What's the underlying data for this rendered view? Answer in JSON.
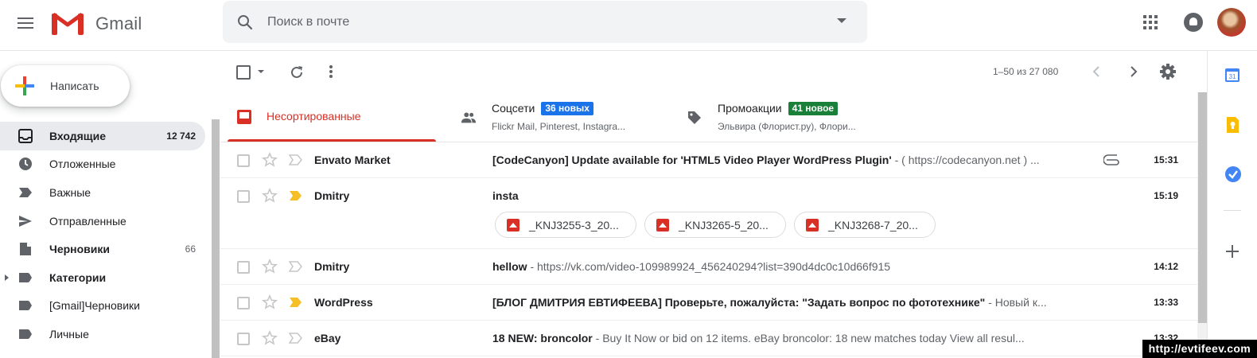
{
  "app": {
    "name": "Gmail"
  },
  "search": {
    "placeholder": "Поиск в почте"
  },
  "compose": {
    "label": "Написать"
  },
  "sidebar": {
    "items": [
      {
        "label": "Входящие",
        "count": "12 742",
        "icon": "inbox-icon",
        "bold": true,
        "active": true
      },
      {
        "label": "Отложенные",
        "count": "",
        "icon": "clock-icon"
      },
      {
        "label": "Важные",
        "count": "",
        "icon": "important-icon"
      },
      {
        "label": "Отправленные",
        "count": "",
        "icon": "send-icon"
      },
      {
        "label": "Черновики",
        "count": "66",
        "icon": "draft-icon",
        "bold": true
      },
      {
        "label": "Категории",
        "count": "",
        "icon": "label-icon",
        "bold": true,
        "expandable": true
      },
      {
        "label": "[Gmail]Черновики",
        "count": "",
        "icon": "label-icon"
      },
      {
        "label": "Личные",
        "count": "",
        "icon": "label-icon"
      }
    ]
  },
  "toolbar": {
    "range": "1–50 из 27 080"
  },
  "tabs": [
    {
      "name": "Несортированные",
      "icon": "inbox-icon",
      "active": true
    },
    {
      "name": "Соцсети",
      "badge": "36 новых",
      "badge_color": "#1a73e8",
      "sub": "Flickr Mail, Pinterest, Instagra...",
      "icon": "people-icon"
    },
    {
      "name": "Промоакции",
      "badge": "41 новое",
      "badge_color": "#188038",
      "sub": "Эльвира (Флорист.ру), Флори...",
      "icon": "tag-icon"
    }
  ],
  "emails": [
    {
      "sender": "Envato Market",
      "subject": "[CodeCanyon] Update available for 'HTML5 Video Player WordPress Plugin'",
      "snippet": " - ( https://codecanyon.net ) ...",
      "time": "15:31",
      "important": false,
      "attachment": true
    },
    {
      "sender": "Dmitry",
      "subject": "insta",
      "snippet": "",
      "time": "15:19",
      "important": true,
      "attachments": [
        "_KNJ3255-3_20...",
        "_KNJ3265-5_20...",
        "_KNJ3268-7_20..."
      ]
    },
    {
      "sender": "Dmitry",
      "subject": "hellow",
      "snippet": " - https://vk.com/video-109989924_456240294?list=390d4dc0c10d66f915",
      "time": "14:12",
      "important": false
    },
    {
      "sender": "WordPress",
      "subject": "[БЛОГ ДМИТРИЯ ЕВТИФЕЕВА] Проверьте, пожалуйста: \"Задать вопрос по фототехнике\"",
      "snippet": " - Новый к...",
      "time": "13:33",
      "important": true
    },
    {
      "sender": "eBay",
      "subject": "18 NEW: broncolor",
      "snippet": " - Buy It Now or bid on 12 items. eBay broncolor: 18 new matches today View all resul...",
      "time": "13:32",
      "important": false
    }
  ],
  "watermark": "http://evtifeev.com",
  "colors": {
    "gmail_red": "#d93025",
    "badge_blue": "#1a73e8",
    "badge_green": "#188038",
    "important_yellow": "#f6bf26"
  }
}
